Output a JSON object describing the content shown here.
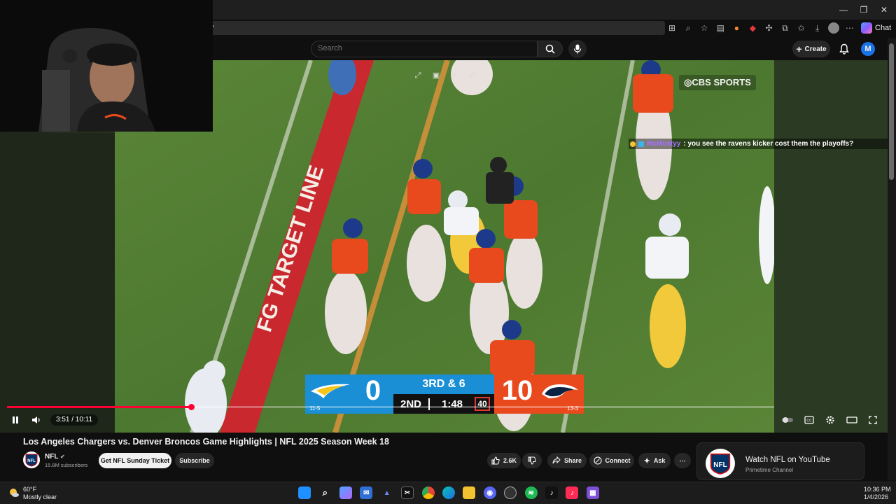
{
  "browser": {
    "address_text": "y",
    "chat_label": "Chat",
    "window_buttons": [
      "—",
      "❐",
      "✕"
    ],
    "toolbar_icons": [
      "grid-icon",
      "zoom-icon",
      "star-icon",
      "reader-icon",
      "extension-orange-icon",
      "extension-red-icon",
      "extensions-icon",
      "split-icon",
      "favorites-icon",
      "download-icon",
      "profile-icon",
      "more-icon"
    ]
  },
  "header": {
    "search_placeholder": "Search",
    "create_label": "Create",
    "avatar_letter": "M"
  },
  "video": {
    "cbs_logo": "◎CBS SPORTS",
    "field_marking": "FG TARGET LINE",
    "chat_message": {
      "username": "McMustyy",
      "text": ": you see the ravens kicker cost them the playoffs?"
    },
    "scorebug": {
      "away_score": "0",
      "away_record": "11-5",
      "home_score": "10",
      "home_record": "13-3",
      "down_distance": "3RD & 6",
      "quarter": "2ND",
      "clock": "1:48",
      "play_clock": "40"
    },
    "progress_fraction": 0.2397,
    "time_display": "3:51 / 10:11"
  },
  "details": {
    "title": "Los Angeles Chargers vs. Denver Broncos Game Highlights | NFL 2025 Season Week 18",
    "channel": "NFL",
    "subscribers": "15.8M subscribers",
    "sunday_ticket_label": "Get NFL Sunday Ticket",
    "subscribe_label": "Subscribe",
    "likes": "2.6K",
    "share_label": "Share",
    "connect_label": "Connect",
    "ask_label": "Ask",
    "promo_title": "Watch NFL on YouTube",
    "promo_sub": "Primetime Channel"
  },
  "taskbar": {
    "temp": "60°F",
    "weather": "Mostly clear",
    "time": "10:36 PM",
    "date": "1/4/2026"
  },
  "colors": {
    "chargers_blue": "#1a8fd6",
    "broncos_orange": "#e8491d",
    "yt_red": "#ff0033",
    "field_green": "#4f7a32"
  }
}
